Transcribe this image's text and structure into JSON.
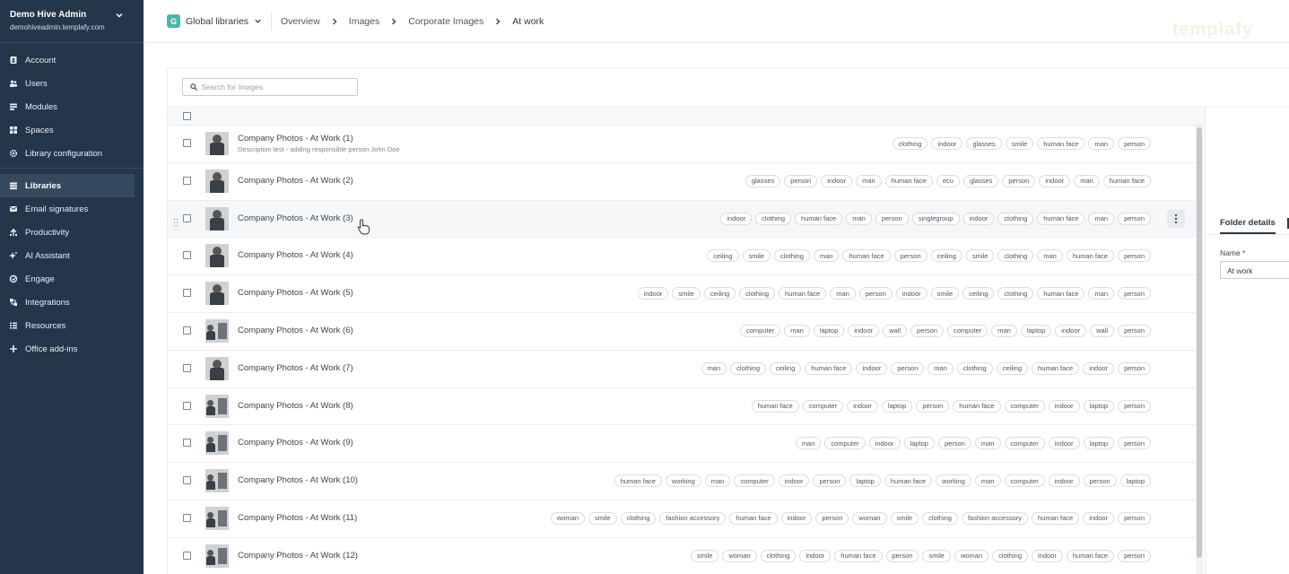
{
  "org": {
    "name": "Demo Hive Admin",
    "url": "demohiveadmin.templafy.com"
  },
  "nav": {
    "group1": [
      {
        "label": "Account",
        "icon": "account-icon"
      },
      {
        "label": "Users",
        "icon": "users-icon"
      },
      {
        "label": "Modules",
        "icon": "modules-icon"
      },
      {
        "label": "Spaces",
        "icon": "spaces-icon"
      },
      {
        "label": "Library configuration",
        "icon": "gear-icon"
      }
    ],
    "group2": [
      {
        "label": "Libraries",
        "icon": "libraries-icon"
      },
      {
        "label": "Email signatures",
        "icon": "mail-icon"
      },
      {
        "label": "Productivity",
        "icon": "productivity-icon"
      },
      {
        "label": "AI Assistant",
        "icon": "sparkle-icon"
      },
      {
        "label": "Engage",
        "icon": "engage-icon"
      },
      {
        "label": "Integrations",
        "icon": "integrations-icon"
      },
      {
        "label": "Resources",
        "icon": "resources-icon"
      },
      {
        "label": "Office add-ins",
        "icon": "plus-icon"
      }
    ]
  },
  "topbar": {
    "library_badge": "G",
    "library": "Global libraries",
    "breadcrumbs": [
      "Overview",
      "Images",
      "Corporate Images",
      "At work"
    ],
    "watermark": "templafy"
  },
  "search": {
    "placeholder": "Search for images"
  },
  "rows": [
    {
      "name": "Company Photos - At Work (1)",
      "desc": "Description test - adding responsible person John Doe",
      "tags": [
        "clothing",
        "indoor",
        "glasses",
        "smile",
        "human face",
        "man",
        "person"
      ]
    },
    {
      "name": "Company Photos - At Work (2)",
      "desc": "",
      "tags": [
        "glasses",
        "person",
        "indoor",
        "man",
        "human face",
        "ecu",
        "glasses",
        "person",
        "indoor",
        "man",
        "human face"
      ]
    },
    {
      "name": "Company Photos - At Work (3)",
      "desc": "",
      "tags": [
        "indoor",
        "clothing",
        "human face",
        "man",
        "person",
        "singlegroup",
        "indoor",
        "clothing",
        "human face",
        "man",
        "person"
      ]
    },
    {
      "name": "Company Photos - At Work (4)",
      "desc": "",
      "tags": [
        "ceiling",
        "smile",
        "clothing",
        "man",
        "human face",
        "person",
        "ceiling",
        "smile",
        "clothing",
        "man",
        "human face",
        "person"
      ]
    },
    {
      "name": "Company Photos - At Work (5)",
      "desc": "",
      "tags": [
        "indoor",
        "smile",
        "ceiling",
        "clothing",
        "human face",
        "man",
        "person",
        "indoor",
        "smile",
        "ceiling",
        "clothing",
        "human face",
        "man",
        "person"
      ]
    },
    {
      "name": "Company Photos - At Work (6)",
      "desc": "",
      "tags": [
        "computer",
        "man",
        "laptop",
        "indoor",
        "wall",
        "person",
        "computer",
        "man",
        "laptop",
        "indoor",
        "wall",
        "person"
      ]
    },
    {
      "name": "Company Photos - At Work (7)",
      "desc": "",
      "tags": [
        "man",
        "clothing",
        "ceiling",
        "human face",
        "indoor",
        "person",
        "man",
        "clothing",
        "ceiling",
        "human face",
        "indoor",
        "person"
      ]
    },
    {
      "name": "Company Photos - At Work (8)",
      "desc": "",
      "tags": [
        "human face",
        "computer",
        "indoor",
        "laptop",
        "person",
        "human face",
        "computer",
        "indoor",
        "laptop",
        "person"
      ]
    },
    {
      "name": "Company Photos - At Work (9)",
      "desc": "",
      "tags": [
        "man",
        "computer",
        "indoor",
        "laptop",
        "person",
        "man",
        "computer",
        "indoor",
        "laptop",
        "person"
      ]
    },
    {
      "name": "Company Photos - At Work (10)",
      "desc": "",
      "tags": [
        "human face",
        "working",
        "man",
        "computer",
        "indoor",
        "person",
        "laptop",
        "human face",
        "working",
        "man",
        "computer",
        "indoor",
        "person",
        "laptop"
      ]
    },
    {
      "name": "Company Photos - At Work (11)",
      "desc": "",
      "tags": [
        "woman",
        "smile",
        "clothing",
        "fashion accessory",
        "human face",
        "indoor",
        "person",
        "woman",
        "smile",
        "clothing",
        "fashion accessory",
        "human face",
        "indoor",
        "person"
      ]
    },
    {
      "name": "Company Photos - At Work (12)",
      "desc": "",
      "tags": [
        "smile",
        "woman",
        "clothing",
        "indoor",
        "human face",
        "person",
        "smile",
        "woman",
        "clothing",
        "indoor",
        "human face",
        "person"
      ]
    }
  ],
  "details": {
    "tab": "Folder details",
    "name_label": "Name *",
    "name_value": "At work"
  }
}
